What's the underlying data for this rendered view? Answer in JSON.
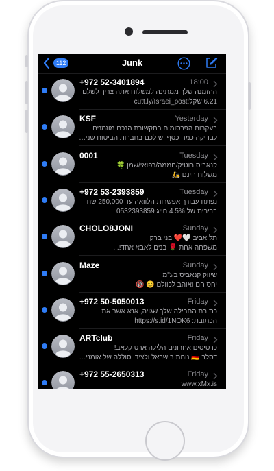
{
  "nav": {
    "badge_count": "112",
    "title": "Junk"
  },
  "messages": [
    {
      "sender": "+972 52-3401894",
      "time": "18:00",
      "line1": "ההזמנה שלך ממתינה למשלוח אתה צריך לשלם",
      "line2": "6.21 שקל:cutt.ly/Israei_post",
      "unread": true
    },
    {
      "sender": "KSF",
      "time": "Yesterday",
      "line1": "בעקבות הפרסומים בתקשורת הנכם מוזמנים",
      "line2": "לבדיקה כמה כסף יש לכם בחברות הביטוח שנית...",
      "unread": true
    },
    {
      "sender": "0001",
      "time": "Tuesday",
      "line1": "קנאביס בוטיק/חממה/רפואי/שמן 🍀",
      "line2": "משלוח חינם 🛵",
      "unread": true
    },
    {
      "sender": "+972 53-2393859",
      "time": "Tuesday",
      "line1": "נפתח עבורך אפשרות הלוואה עד 250,000 שח",
      "line2": "בריבית של 4.5% חייג 0532393859",
      "unread": true
    },
    {
      "sender": "CHOLO8JONI",
      "time": "Sunday",
      "line1": "תל אביב 🤍❤️ בני ברק",
      "line2": "משפחה אחת 🌹 בנים לאבא אחד!...",
      "unread": true
    },
    {
      "sender": "Maze",
      "time": "Sunday",
      "line1": "שיווק קנאביס בע\"מ",
      "line2": "יחס חם ואוהב לכוולם 😊 🔞",
      "unread": true
    },
    {
      "sender": "+972 50-5050013",
      "time": "Friday",
      "line1": "כתובת החבילה שלך שגויה, אנא אשר את",
      "line2": "הכתובת: https://s.id/1NOK6",
      "unread": true
    },
    {
      "sender": "ARTclub",
      "time": "Friday",
      "line1": "כרטיסים אחרונים הלילה ארט קלאב!",
      "line2": "דסלר 🇩🇪 נוחת בישראל ולצידו סוללה של אומנים...",
      "unread": true
    },
    {
      "sender": "+972 55-2650313",
      "time": "Friday",
      "line1": "www.xMx.is",
      "line2": "",
      "unread": true
    }
  ],
  "icons": {
    "back": "chevron-left-icon",
    "more": "ellipsis-circle-icon",
    "compose": "compose-icon",
    "avatar": "person-placeholder-icon",
    "row_chevron": "chevron-right-icon"
  },
  "colors": {
    "accent": "#2f7cf6",
    "background": "#000000",
    "secondary_text": "#8e8e93"
  }
}
